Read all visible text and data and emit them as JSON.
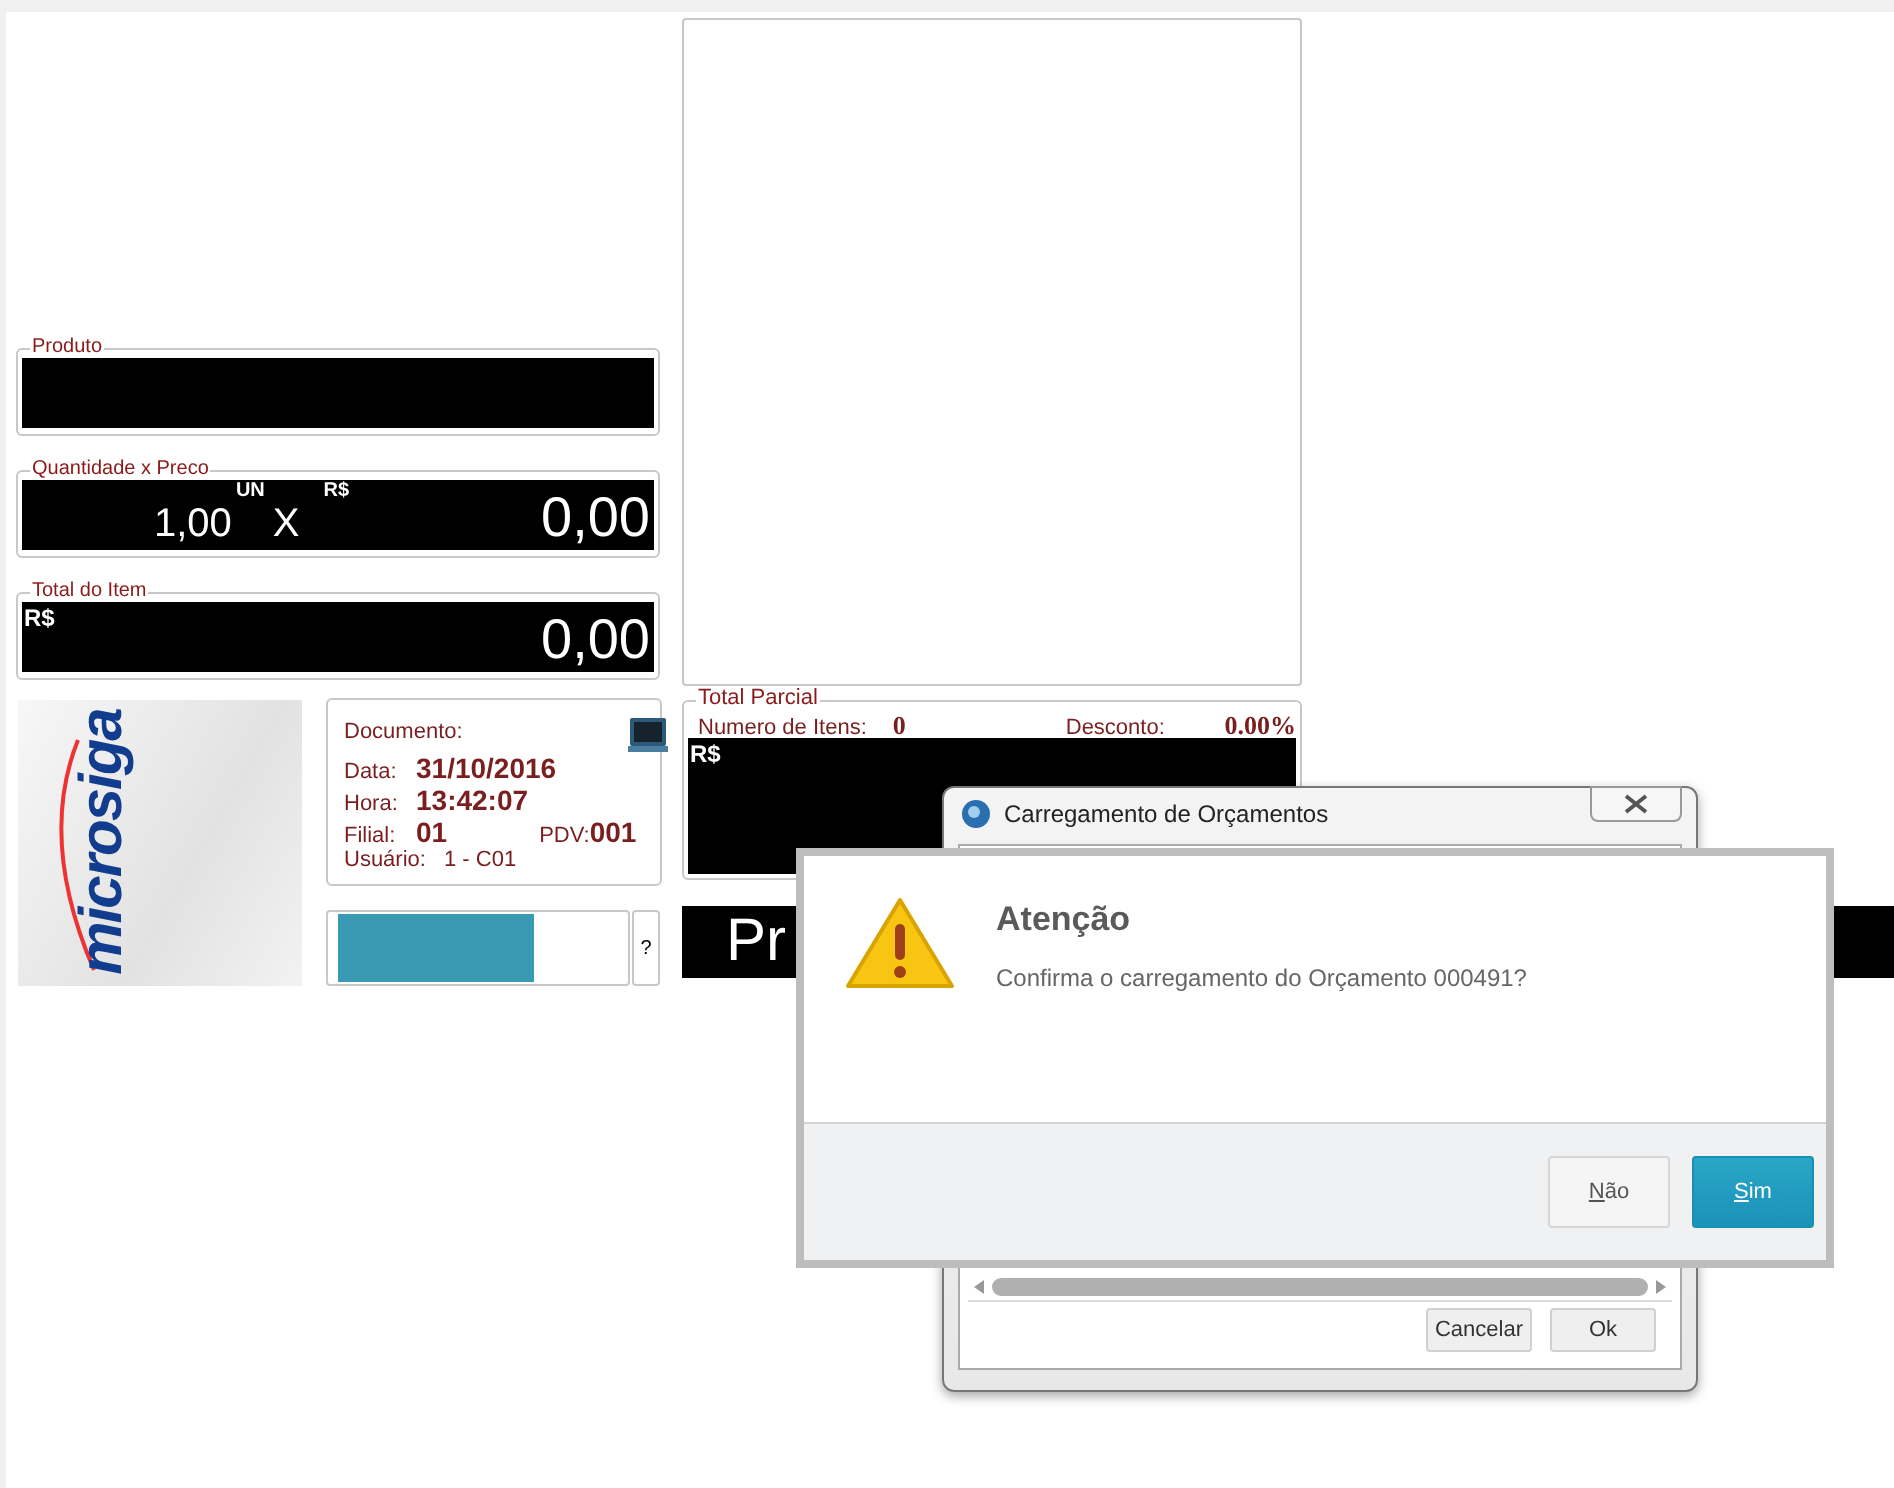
{
  "fields": [
    {
      "label": "Produto",
      "kind": "empty"
    },
    {
      "label": "Quantidade x Preco",
      "kind": "qty_price",
      "quantity": "1,00",
      "unit": "UN",
      "times": "X",
      "currency": "R$",
      "value": "0,00"
    },
    {
      "label": "Total do Item",
      "kind": "total",
      "currency": "R$",
      "value": "0,00"
    }
  ],
  "logo": {
    "text": "microsiga"
  },
  "info": {
    "lines": [
      {
        "kind": "header",
        "label": "Documento:"
      },
      {
        "kind": "pair",
        "label": "Data:",
        "value": "31/10/2016"
      },
      {
        "kind": "pair",
        "label": "Hora:",
        "value": "13:42:07"
      },
      {
        "kind": "double",
        "label": "Filial:",
        "value": "01",
        "label2": "PDV:",
        "value2": "001"
      },
      {
        "kind": "small",
        "label": "Usuário:",
        "value": "1 - C01"
      }
    ]
  },
  "progress": {
    "level": 0.7,
    "help": "?"
  },
  "total_parcial": {
    "title": "Total Parcial",
    "items_label": "Numero de Itens:",
    "items_value": "0",
    "discount_label": "Desconto:",
    "discount_value": "0.00%",
    "currency": "R$"
  },
  "product_bar": {
    "text": "Pr"
  },
  "back_window": {
    "title": "Carregamento de Orçamentos",
    "buttons": [
      "Cancelar",
      "Ok"
    ]
  },
  "alert": {
    "title": "Atenção",
    "message": "Confirma o carregamento do Orçamento 000491?",
    "buttons": [
      {
        "label": "Não",
        "kind": "default"
      },
      {
        "label": "Sim",
        "kind": "primary"
      }
    ]
  }
}
